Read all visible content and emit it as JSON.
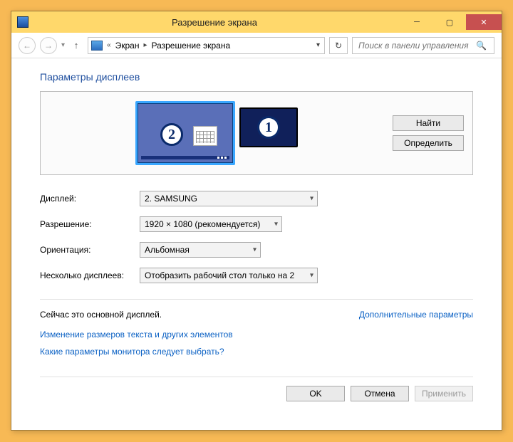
{
  "window": {
    "title": "Разрешение экрана"
  },
  "breadcrumb": {
    "root_glyph": "«",
    "item1": "Экран",
    "item2": "Разрешение экрана"
  },
  "search": {
    "placeholder": "Поиск в панели управления"
  },
  "section_title": "Параметры дисплеев",
  "monitors": {
    "m2_label": "2",
    "m1_label": "1"
  },
  "side_buttons": {
    "find": "Найти",
    "identify": "Определить"
  },
  "form": {
    "display_label": "Дисплей:",
    "display_value": "2. SAMSUNG",
    "resolution_label": "Разрешение:",
    "resolution_value": "1920 × 1080 (рекомендуется)",
    "orientation_label": "Ориентация:",
    "orientation_value": "Альбомная",
    "multi_label": "Несколько дисплеев:",
    "multi_value": "Отобразить рабочий стол только на 2"
  },
  "info": {
    "primary_text": "Сейчас это основной дисплей.",
    "advanced_link": "Дополнительные параметры"
  },
  "links": {
    "text_size": "Изменение размеров текста и других элементов",
    "help": "Какие параметры монитора следует выбрать?"
  },
  "footer": {
    "ok": "OK",
    "cancel": "Отмена",
    "apply": "Применить"
  }
}
